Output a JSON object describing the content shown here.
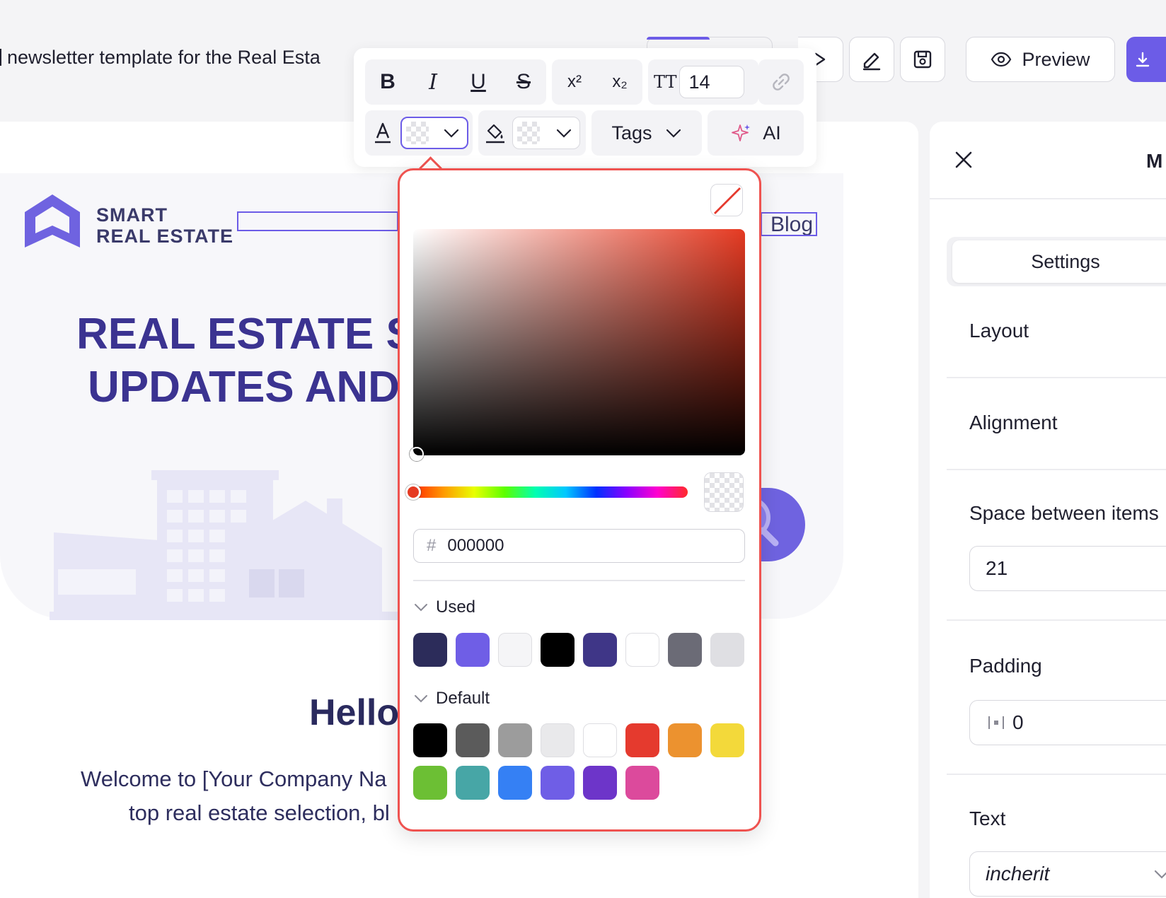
{
  "document": {
    "title": "newsletter template for the Real Esta"
  },
  "topbar": {
    "preview_label": "Preview"
  },
  "email": {
    "logo_line1": "SMART",
    "logo_line2": "REAL ESTATE",
    "nav_blog": "Blog",
    "hero_line1": "REAL ESTATE S",
    "hero_line2": "UPDATES AND",
    "hello": "Hello",
    "welcome_line1": "Welcome to [Your Company Na",
    "welcome_line2": "top real estate selection, bl"
  },
  "toolbar": {
    "bold": "B",
    "italic": "I",
    "underline": "U",
    "strike": "S",
    "superscript": "x²",
    "subscript": "x₂",
    "size_icon": "TT",
    "font_size": "14",
    "tags_label": "Tags",
    "ai_label": "AI"
  },
  "picker": {
    "hex_prefix": "#",
    "hex_value": "000000",
    "used_label": "Used",
    "default_label": "Default",
    "hue_color": "#e53a22",
    "used_colors": [
      "#2c2c5a",
      "#6f5ee6",
      "#f5f5f7",
      "#000000",
      "#3f3687",
      "#ffffff",
      "#6b6b76",
      "#dfdfe3"
    ],
    "default_colors": [
      "#000000",
      "#5b5b5b",
      "#9c9c9c",
      "#e9e9eb",
      "#ffffff",
      "#e53a2e",
      "#ec922f",
      "#f3d93a",
      "#6cbf34",
      "#47a6a6",
      "#3580f4",
      "#6f5ee6",
      "#6d35c9",
      "#dc4a9c"
    ]
  },
  "panel": {
    "title_partial": "M",
    "tab_settings": "Settings",
    "layout_label": "Layout",
    "alignment_label": "Alignment",
    "space_label": "Space between items",
    "space_value": "21",
    "padding_label": "Padding",
    "padding_value": "0",
    "text_label": "Text",
    "text_value": "incherit"
  }
}
